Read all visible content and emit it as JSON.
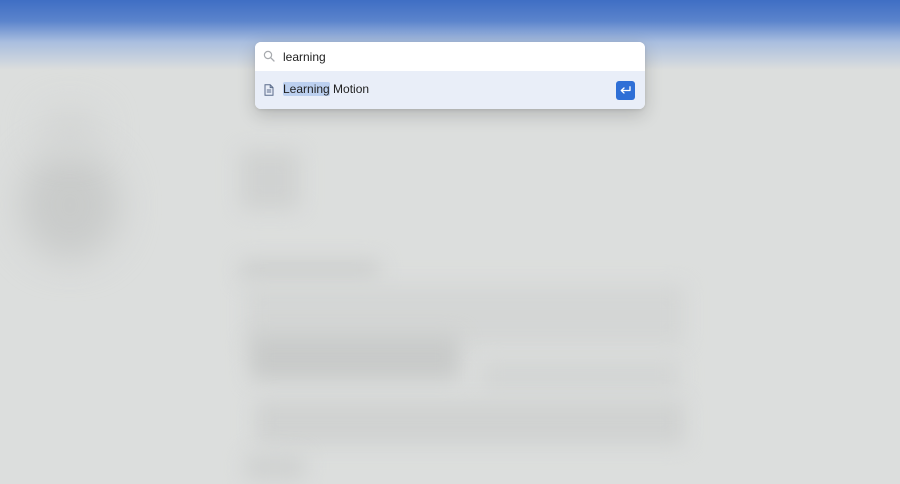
{
  "search": {
    "query": "learning",
    "icon": "search-icon"
  },
  "results": [
    {
      "icon": "document-icon",
      "match": "Learning",
      "rest": " Motion",
      "action_icon": "enter-icon"
    }
  ],
  "colors": {
    "accent": "#2f6fd6",
    "highlight": "#bcd0ef",
    "result_bg": "#e9eef8",
    "topbar": "#3f6ec4"
  }
}
